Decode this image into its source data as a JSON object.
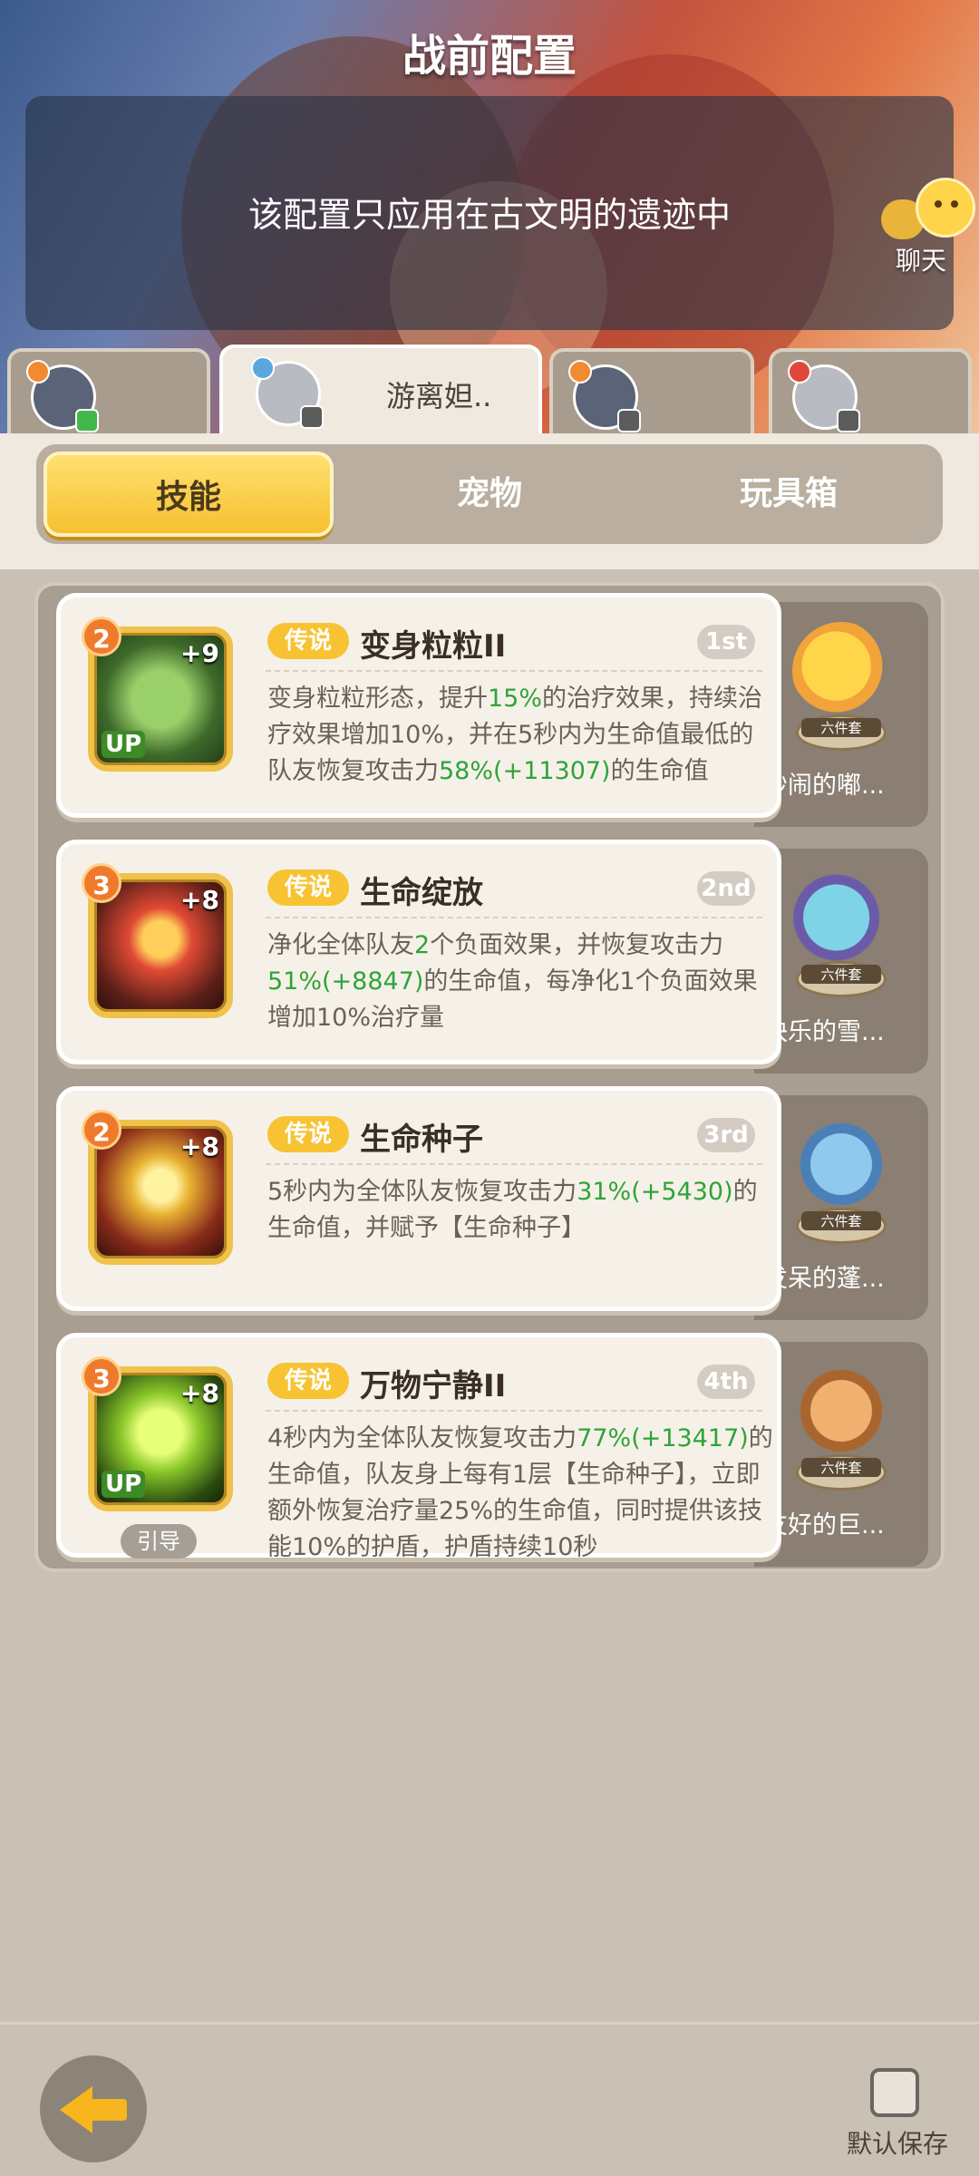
{
  "header": {
    "title": "战前配置",
    "notice": "该配置只应用在古文明的遗迹中",
    "chat_label": "聊天"
  },
  "player_tabs": [
    {
      "name": "",
      "active": false
    },
    {
      "name": "游离妲..",
      "active": true
    },
    {
      "name": "",
      "active": false
    },
    {
      "name": "",
      "active": false
    }
  ],
  "category_tabs": [
    "技能",
    "宠物",
    "玩具箱"
  ],
  "skills": [
    {
      "level": "2",
      "bonus": "+9",
      "up": "UP",
      "badge": "传说",
      "name": "变身粒粒II",
      "rank": "1st",
      "desc_parts": [
        "变身粒粒形态，提升",
        "15%",
        "的治疗效果，持续治疗效果增加10%，并在5秒内为生命值最低的队友恢复攻击力",
        "58%(+11307)",
        "的生命值"
      ],
      "pet": "吵闹的嘟..."
    },
    {
      "level": "3",
      "bonus": "+8",
      "up": "",
      "badge": "传说",
      "name": "生命绽放",
      "rank": "2nd",
      "desc_parts": [
        "净化全体队友",
        "2",
        "个负面效果，并恢复攻击力",
        "51%(+8847)",
        "的生命值，每净化1个负面效果增加10%治疗量"
      ],
      "pet": "快乐的雪..."
    },
    {
      "level": "2",
      "bonus": "+8",
      "up": "",
      "badge": "传说",
      "name": "生命种子",
      "rank": "3rd",
      "desc_parts": [
        "5秒内为全体队友恢复攻击力",
        "31%(+5430)",
        "的生命值，并赋予【生命种子】",
        "",
        ""
      ],
      "pet": "发呆的蓬..."
    },
    {
      "level": "3",
      "bonus": "+8",
      "up": "UP",
      "badge": "传说",
      "name": "万物宁静II",
      "rank": "4th",
      "guide": "引导",
      "desc_parts": [
        "4秒内为全体队友恢复攻击力",
        "77%(+13417)",
        "的生命值，队友身上每有1层【生命种子】，立即额外恢复治疗量25%的生命值，同时提供该技能10%的护盾，护盾持续10秒",
        "",
        ""
      ],
      "pet": "友好的巨..."
    }
  ],
  "pet_set_label": "六件套",
  "footer": {
    "save_label": "默认保存"
  },
  "colors": {
    "accent": "#f7c333",
    "highlight": "#2ea43a",
    "panel": "#f6f1e8"
  },
  "icons": {
    "back": "back-arrow-icon",
    "chat": "chat-emoji-icon",
    "save": "checkbox-icon"
  }
}
